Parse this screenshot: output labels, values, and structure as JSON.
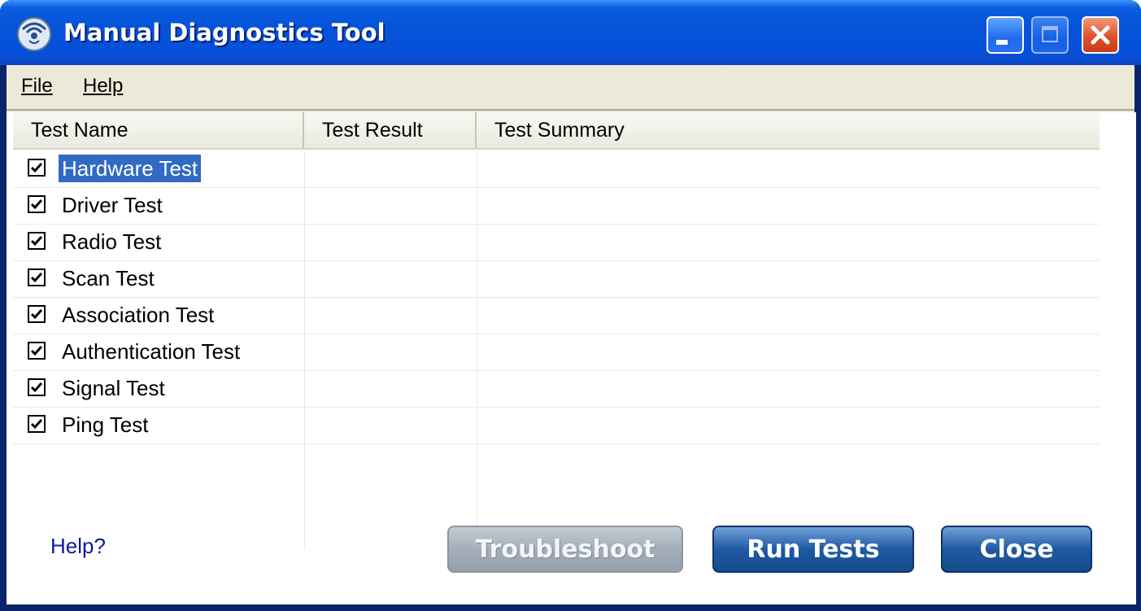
{
  "window": {
    "title": "Manual Diagnostics Tool"
  },
  "menu": {
    "file": "File",
    "help": "Help"
  },
  "table": {
    "columns": [
      "Test Name",
      "Test Result",
      "Test Summary"
    ],
    "rows": [
      {
        "name": "Hardware Test",
        "checked": true,
        "selected": true
      },
      {
        "name": "Driver Test",
        "checked": true
      },
      {
        "name": "Radio Test",
        "checked": true
      },
      {
        "name": "Scan Test",
        "checked": true
      },
      {
        "name": "Association Test",
        "checked": true
      },
      {
        "name": "Authentication Test",
        "checked": true
      },
      {
        "name": "Signal Test",
        "checked": true
      },
      {
        "name": "Ping Test",
        "checked": true
      }
    ]
  },
  "footer": {
    "help_link": "Help?",
    "troubleshoot": "Troubleshoot",
    "run_tests": "Run Tests",
    "close": "Close"
  },
  "colors": {
    "titlebar": "#0553d8",
    "selection": "#316ac5",
    "button_blue": "#1e5aa3",
    "button_disabled": "#a3aeb8"
  },
  "icons": [
    "wireless-icon",
    "minimize-icon",
    "maximize-icon",
    "close-icon",
    "checkbox-checked-icon"
  ]
}
